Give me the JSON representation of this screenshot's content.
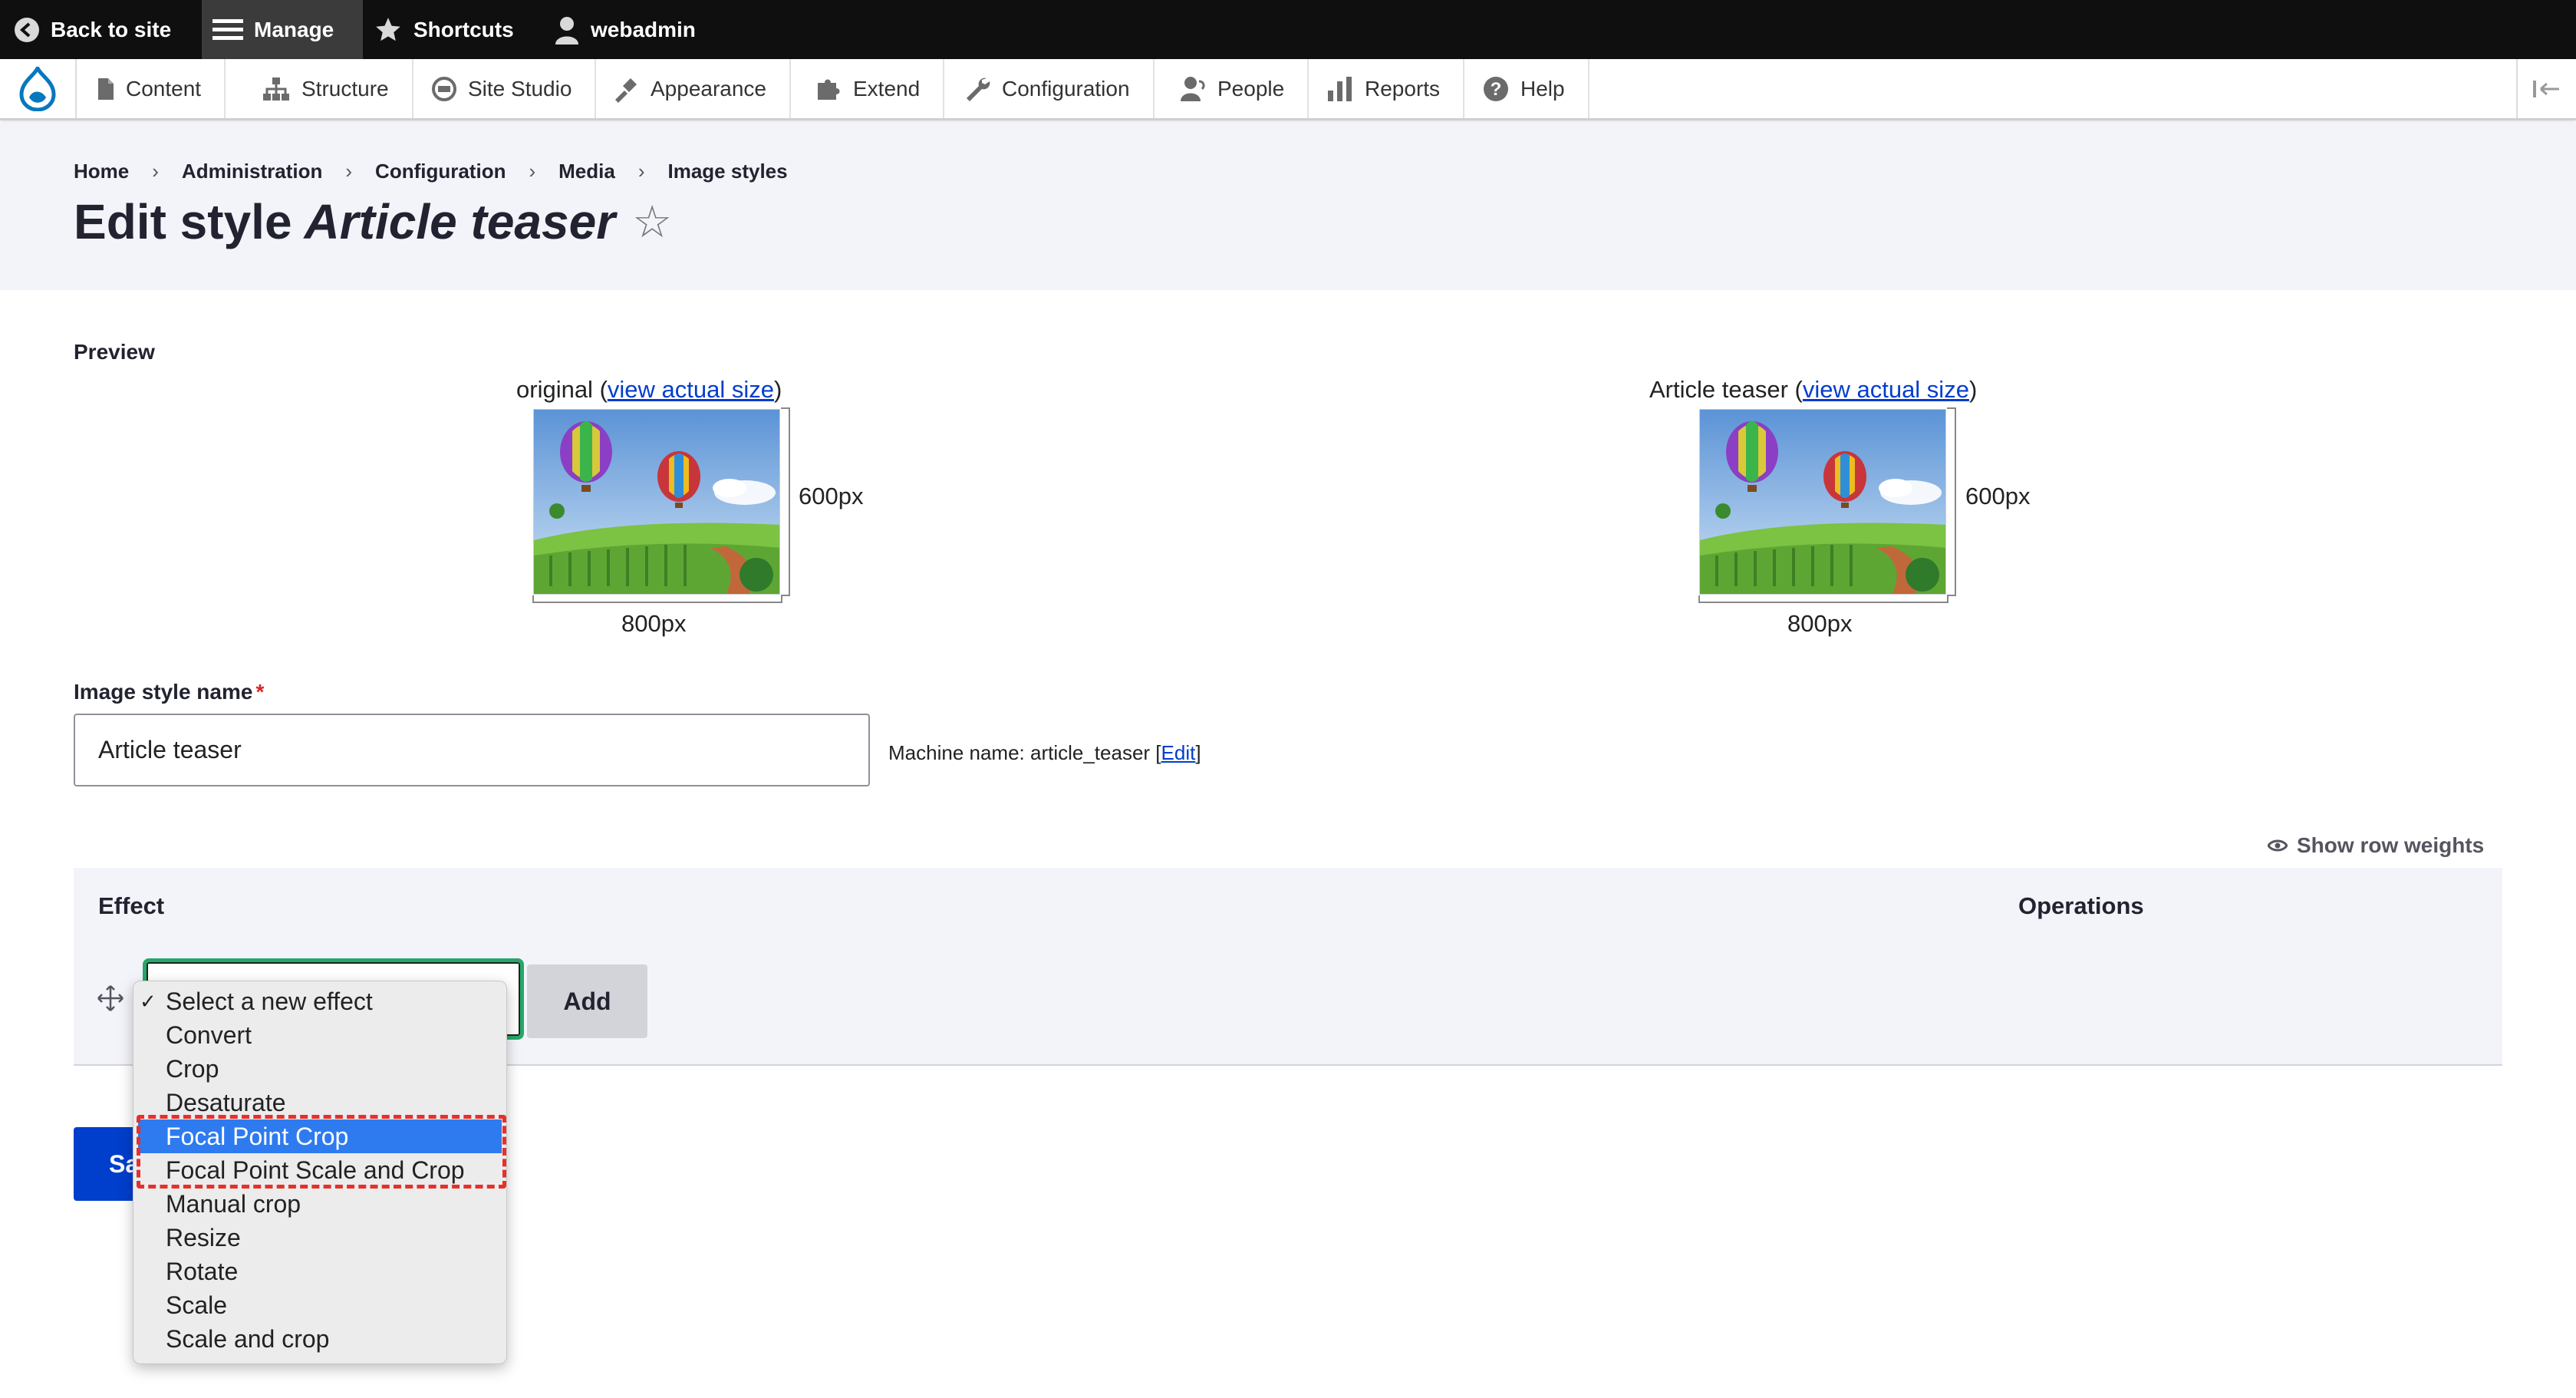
{
  "toolbar": {
    "back_label": "Back to site",
    "manage_label": "Manage",
    "shortcuts_label": "Shortcuts",
    "user_label": "webadmin"
  },
  "tray": {
    "items": [
      {
        "label": "Content",
        "icon": "file-icon"
      },
      {
        "label": "Structure",
        "icon": "sitemap-icon"
      },
      {
        "label": "Site Studio",
        "icon": "site-studio-icon"
      },
      {
        "label": "Appearance",
        "icon": "paintbrush-icon"
      },
      {
        "label": "Extend",
        "icon": "puzzle-icon"
      },
      {
        "label": "Configuration",
        "icon": "wrench-icon"
      },
      {
        "label": "People",
        "icon": "person-icon"
      },
      {
        "label": "Reports",
        "icon": "bar-chart-icon"
      },
      {
        "label": "Help",
        "icon": "help-icon"
      }
    ]
  },
  "breadcrumb": [
    "Home",
    "Administration",
    "Configuration",
    "Media",
    "Image styles"
  ],
  "page": {
    "title_prefix": "Edit style",
    "title_name": "Article teaser",
    "star": "☆"
  },
  "preview": {
    "label": "Preview",
    "original_caption": "original",
    "styled_caption": "Article teaser",
    "link_text": "view actual size",
    "height_label": "600px",
    "width_label": "800px"
  },
  "form": {
    "name_label": "Image style name",
    "required_mark": "*",
    "name_value": "Article teaser",
    "machine_name_label": "Machine name: article_teaser",
    "machine_name_edit": "Edit",
    "show_weights": "Show row weights"
  },
  "effects": {
    "col_effect": "Effect",
    "col_operations": "Operations",
    "add_label": "Add",
    "save_label": "Sa",
    "options": [
      "Select a new effect",
      "Convert",
      "Crop",
      "Desaturate",
      "Focal Point Crop",
      "Focal Point Scale and Crop",
      "Manual crop",
      "Resize",
      "Rotate",
      "Scale",
      "Scale and crop"
    ],
    "checked_option": "Select a new effect",
    "highlighted_option": "Focal Point Crop",
    "check_mark": "✓"
  },
  "colors": {
    "primary_blue": "#003ecc",
    "focus_green": "#26a769",
    "highlight_red": "#e5302b",
    "menu_selection": "#2e7bf0"
  }
}
